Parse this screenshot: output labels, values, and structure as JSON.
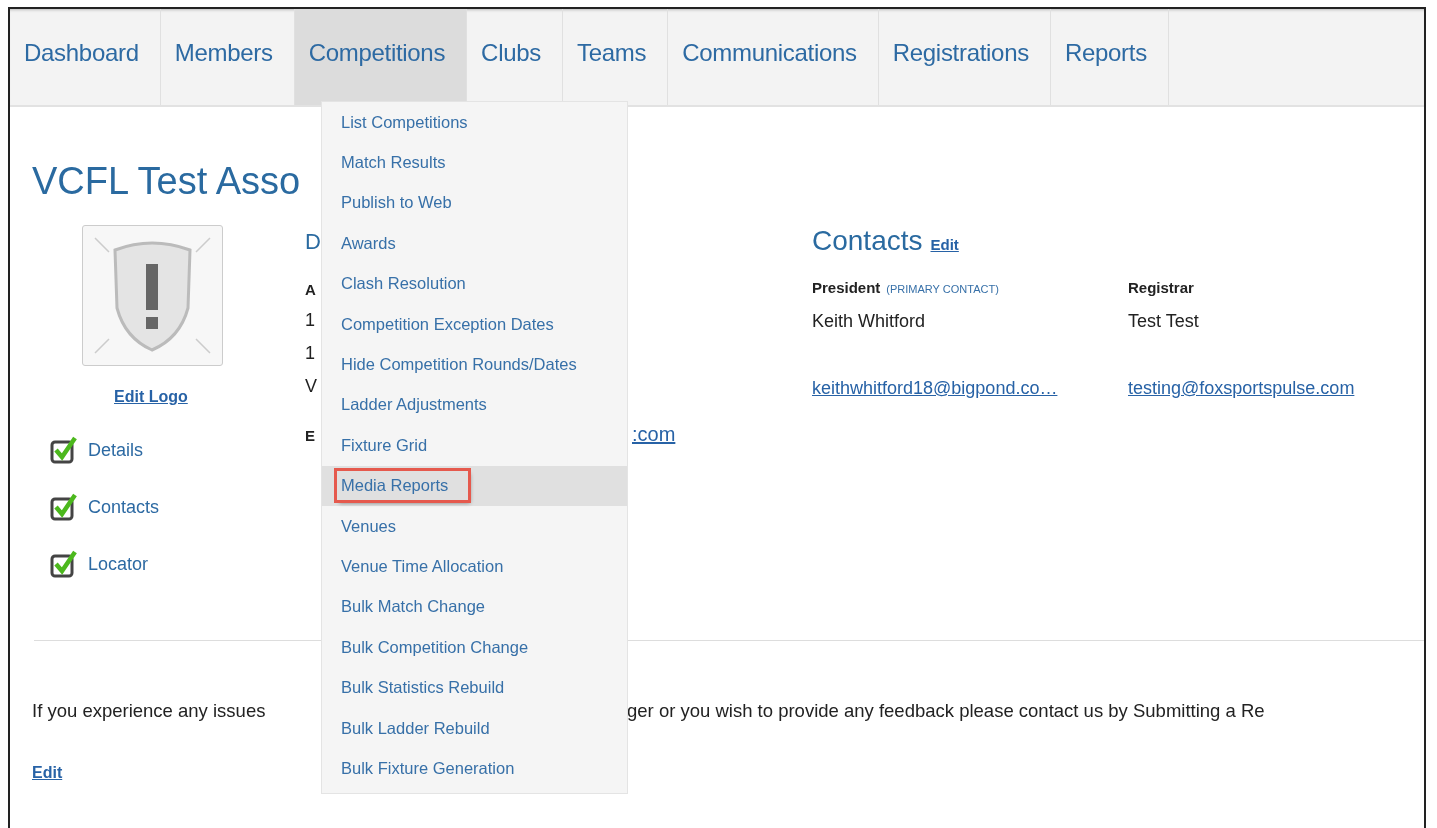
{
  "nav": {
    "tabs": [
      {
        "label": "Dashboard",
        "selected": false
      },
      {
        "label": "Members",
        "selected": false
      },
      {
        "label": "Competitions",
        "selected": true
      },
      {
        "label": "Clubs",
        "selected": false
      },
      {
        "label": "Teams",
        "selected": false
      },
      {
        "label": "Communications",
        "selected": false
      },
      {
        "label": "Registrations",
        "selected": false
      },
      {
        "label": "Reports",
        "selected": false
      }
    ]
  },
  "dropdown": {
    "items": [
      {
        "label": "List Competitions",
        "selected": false,
        "outlined": false
      },
      {
        "label": "Match Results",
        "selected": false,
        "outlined": false
      },
      {
        "label": "Publish to Web",
        "selected": false,
        "outlined": false
      },
      {
        "label": "Awards",
        "selected": false,
        "outlined": false
      },
      {
        "label": "Clash Resolution",
        "selected": false,
        "outlined": false
      },
      {
        "label": "Competition Exception Dates",
        "selected": false,
        "outlined": false
      },
      {
        "label": "Hide Competition Rounds/Dates",
        "selected": false,
        "outlined": false
      },
      {
        "label": "Ladder Adjustments",
        "selected": false,
        "outlined": false
      },
      {
        "label": "Fixture Grid",
        "selected": false,
        "outlined": false
      },
      {
        "label": "Media Reports",
        "selected": true,
        "outlined": true
      },
      {
        "label": "Venues",
        "selected": false,
        "outlined": false
      },
      {
        "label": "Venue Time Allocation",
        "selected": false,
        "outlined": false
      },
      {
        "label": "Bulk Match Change",
        "selected": false,
        "outlined": false
      },
      {
        "label": "Bulk Competition Change",
        "selected": false,
        "outlined": false
      },
      {
        "label": "Bulk Statistics Rebuild",
        "selected": false,
        "outlined": false
      },
      {
        "label": "Bulk Ladder Rebuild",
        "selected": false,
        "outlined": false
      },
      {
        "label": "Bulk Fixture Generation",
        "selected": false,
        "outlined": false
      }
    ]
  },
  "page": {
    "title": "VCFL Test Asso",
    "logo_link": "Edit Logo",
    "checklist": [
      {
        "label": "Details",
        "checked": true
      },
      {
        "label": "Contacts",
        "checked": true
      },
      {
        "label": "Locator",
        "checked": true
      }
    ],
    "details": {
      "heading": "D",
      "label": "A",
      "lines": [
        "1",
        "1",
        "V"
      ],
      "email_label": "E",
      "email_link": ":com"
    },
    "contacts": {
      "heading": "Contacts",
      "edit": "Edit",
      "people": [
        {
          "role": "President",
          "note": "(PRIMARY CONTACT)",
          "name": "Keith Whitford",
          "email": "keithwhitford18@bigpond.co…"
        },
        {
          "role": "Registrar",
          "name": "Test Test",
          "email": "testing@foxsportspulse.com"
        }
      ]
    },
    "footer": {
      "text_left": "If you experience any issues",
      "text_right": "ger or you wish to provide any feedback please contact us by Submitting a Re",
      "edit": "Edit"
    }
  }
}
